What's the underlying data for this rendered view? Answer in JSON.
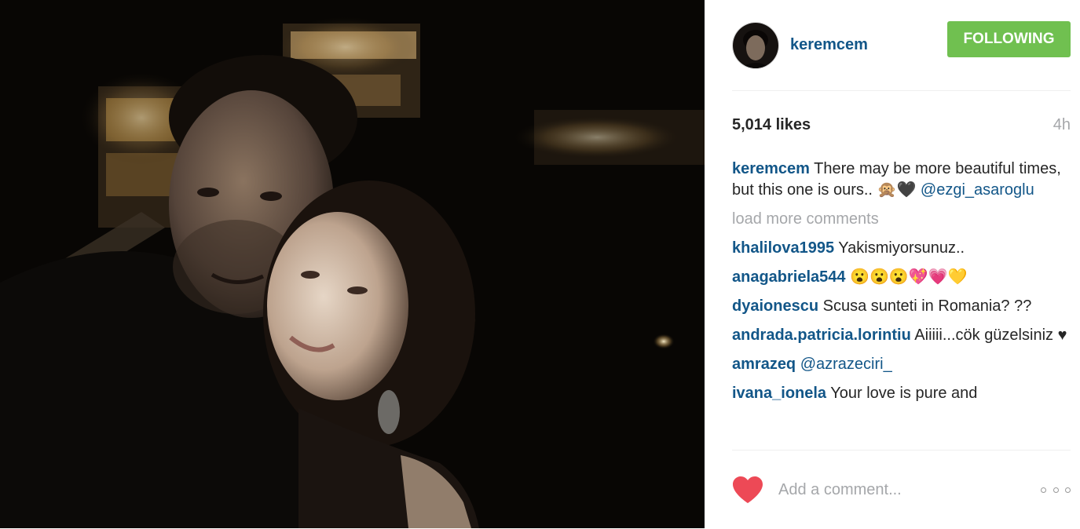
{
  "post": {
    "image_alt": "Post photo",
    "username": "keremcem",
    "follow_label": "FOLLOWING",
    "likes": "5,014 likes",
    "time": "4h"
  },
  "caption": {
    "user": "keremcem",
    "text": " There may be more beautiful times, but this one is ours.. 🙊🖤 ",
    "mention": "@ezgi_asaroglu"
  },
  "load_more_label": "load more comments",
  "comments": [
    {
      "user": "khalilova1995",
      "text": " Yakismiyorsunuz.."
    },
    {
      "user": "anagabriela544",
      "text": " 😮😮😮💖💗💛"
    },
    {
      "user": "dyaionescu",
      "text": " Scusa sunteti in Romania? ??"
    },
    {
      "user": "andrada.patricia.lorintiu",
      "text": " Aiiiii...cök güzelsiniz ♥"
    },
    {
      "user": "amrazeq",
      "text": " @azrazeciri_"
    },
    {
      "user": "ivana_ionela",
      "text": " Your love is pure and"
    }
  ],
  "footer": {
    "comment_placeholder": "Add a comment..."
  },
  "colors": {
    "following_button": "#70c050",
    "username": "#125688",
    "heart": "#ed4956",
    "muted": "#a5a7aa"
  },
  "icons": {
    "like": "heart-icon",
    "more": "more-options-icon"
  }
}
